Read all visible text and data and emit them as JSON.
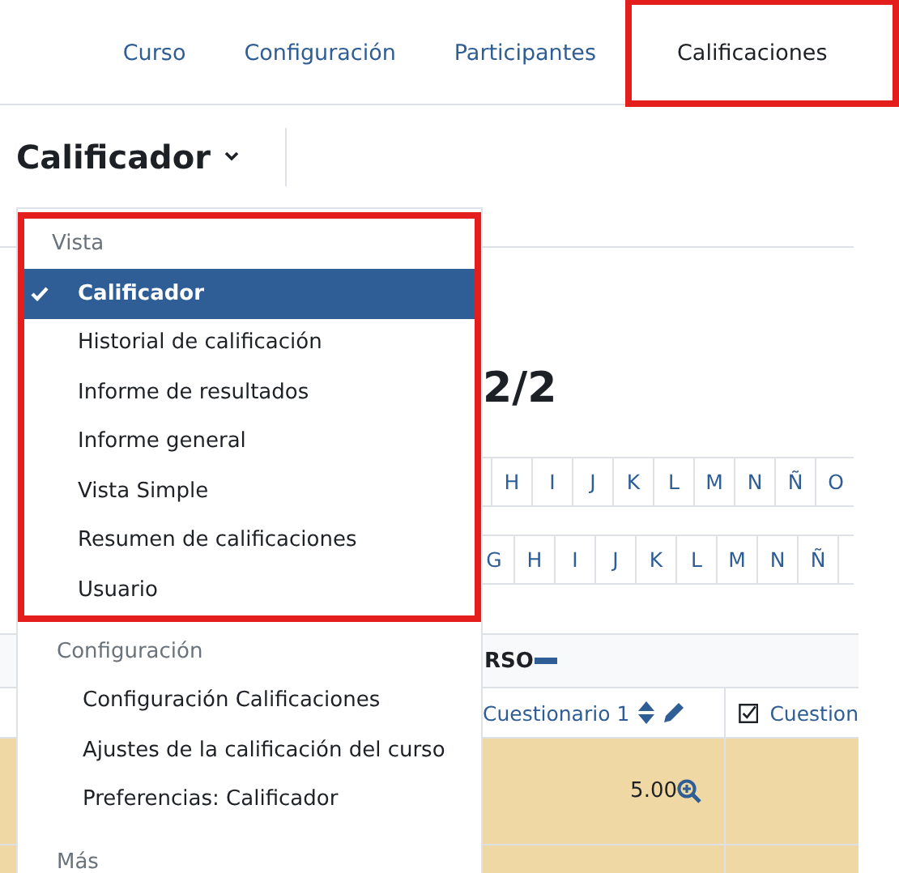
{
  "nav": [
    {
      "label": "Curso",
      "selected": false,
      "highlighted": false
    },
    {
      "label": "Configuración",
      "selected": false,
      "highlighted": false
    },
    {
      "label": "Participantes",
      "selected": false,
      "highlighted": false
    },
    {
      "label": "Calificaciones",
      "selected": true,
      "highlighted": true
    }
  ],
  "page_title": "Calificador",
  "menu": [
    {
      "heading": "Vista",
      "highlighted": true,
      "items": [
        {
          "label": "Calificador",
          "selected": true
        },
        {
          "label": "Historial de calificación",
          "selected": false
        },
        {
          "label": "Informe de resultados",
          "selected": false
        },
        {
          "label": "Informe general",
          "selected": false
        },
        {
          "label": "Vista Simple",
          "selected": false
        },
        {
          "label": "Resumen de calificaciones",
          "selected": false
        },
        {
          "label": "Usuario",
          "selected": false
        }
      ]
    },
    {
      "heading": "Configuración",
      "highlighted": false,
      "items": [
        {
          "label": "Configuración Calificaciones",
          "selected": false
        },
        {
          "label": "Ajustes de la calificación del curso",
          "selected": false
        },
        {
          "label": "Preferencias: Calificador",
          "selected": false
        }
      ]
    },
    {
      "heading": "Más",
      "highlighted": false
    }
  ],
  "heading": "2/2",
  "letter_rows": [
    [
      "H",
      "I",
      "J",
      "K",
      "L",
      "M",
      "N",
      "Ñ",
      "O"
    ],
    [
      "G",
      "H",
      "I",
      "J",
      "K",
      "L",
      "M",
      "N",
      "Ñ"
    ]
  ],
  "table": {
    "category": "RSO",
    "columns": [
      {
        "label": "Cuestionario 1",
        "kind": "sortable"
      },
      {
        "label": "Cuestion",
        "kind": "checkable"
      }
    ],
    "rows": [
      [
        "5.00",
        ""
      ],
      [
        "",
        ""
      ]
    ]
  }
}
